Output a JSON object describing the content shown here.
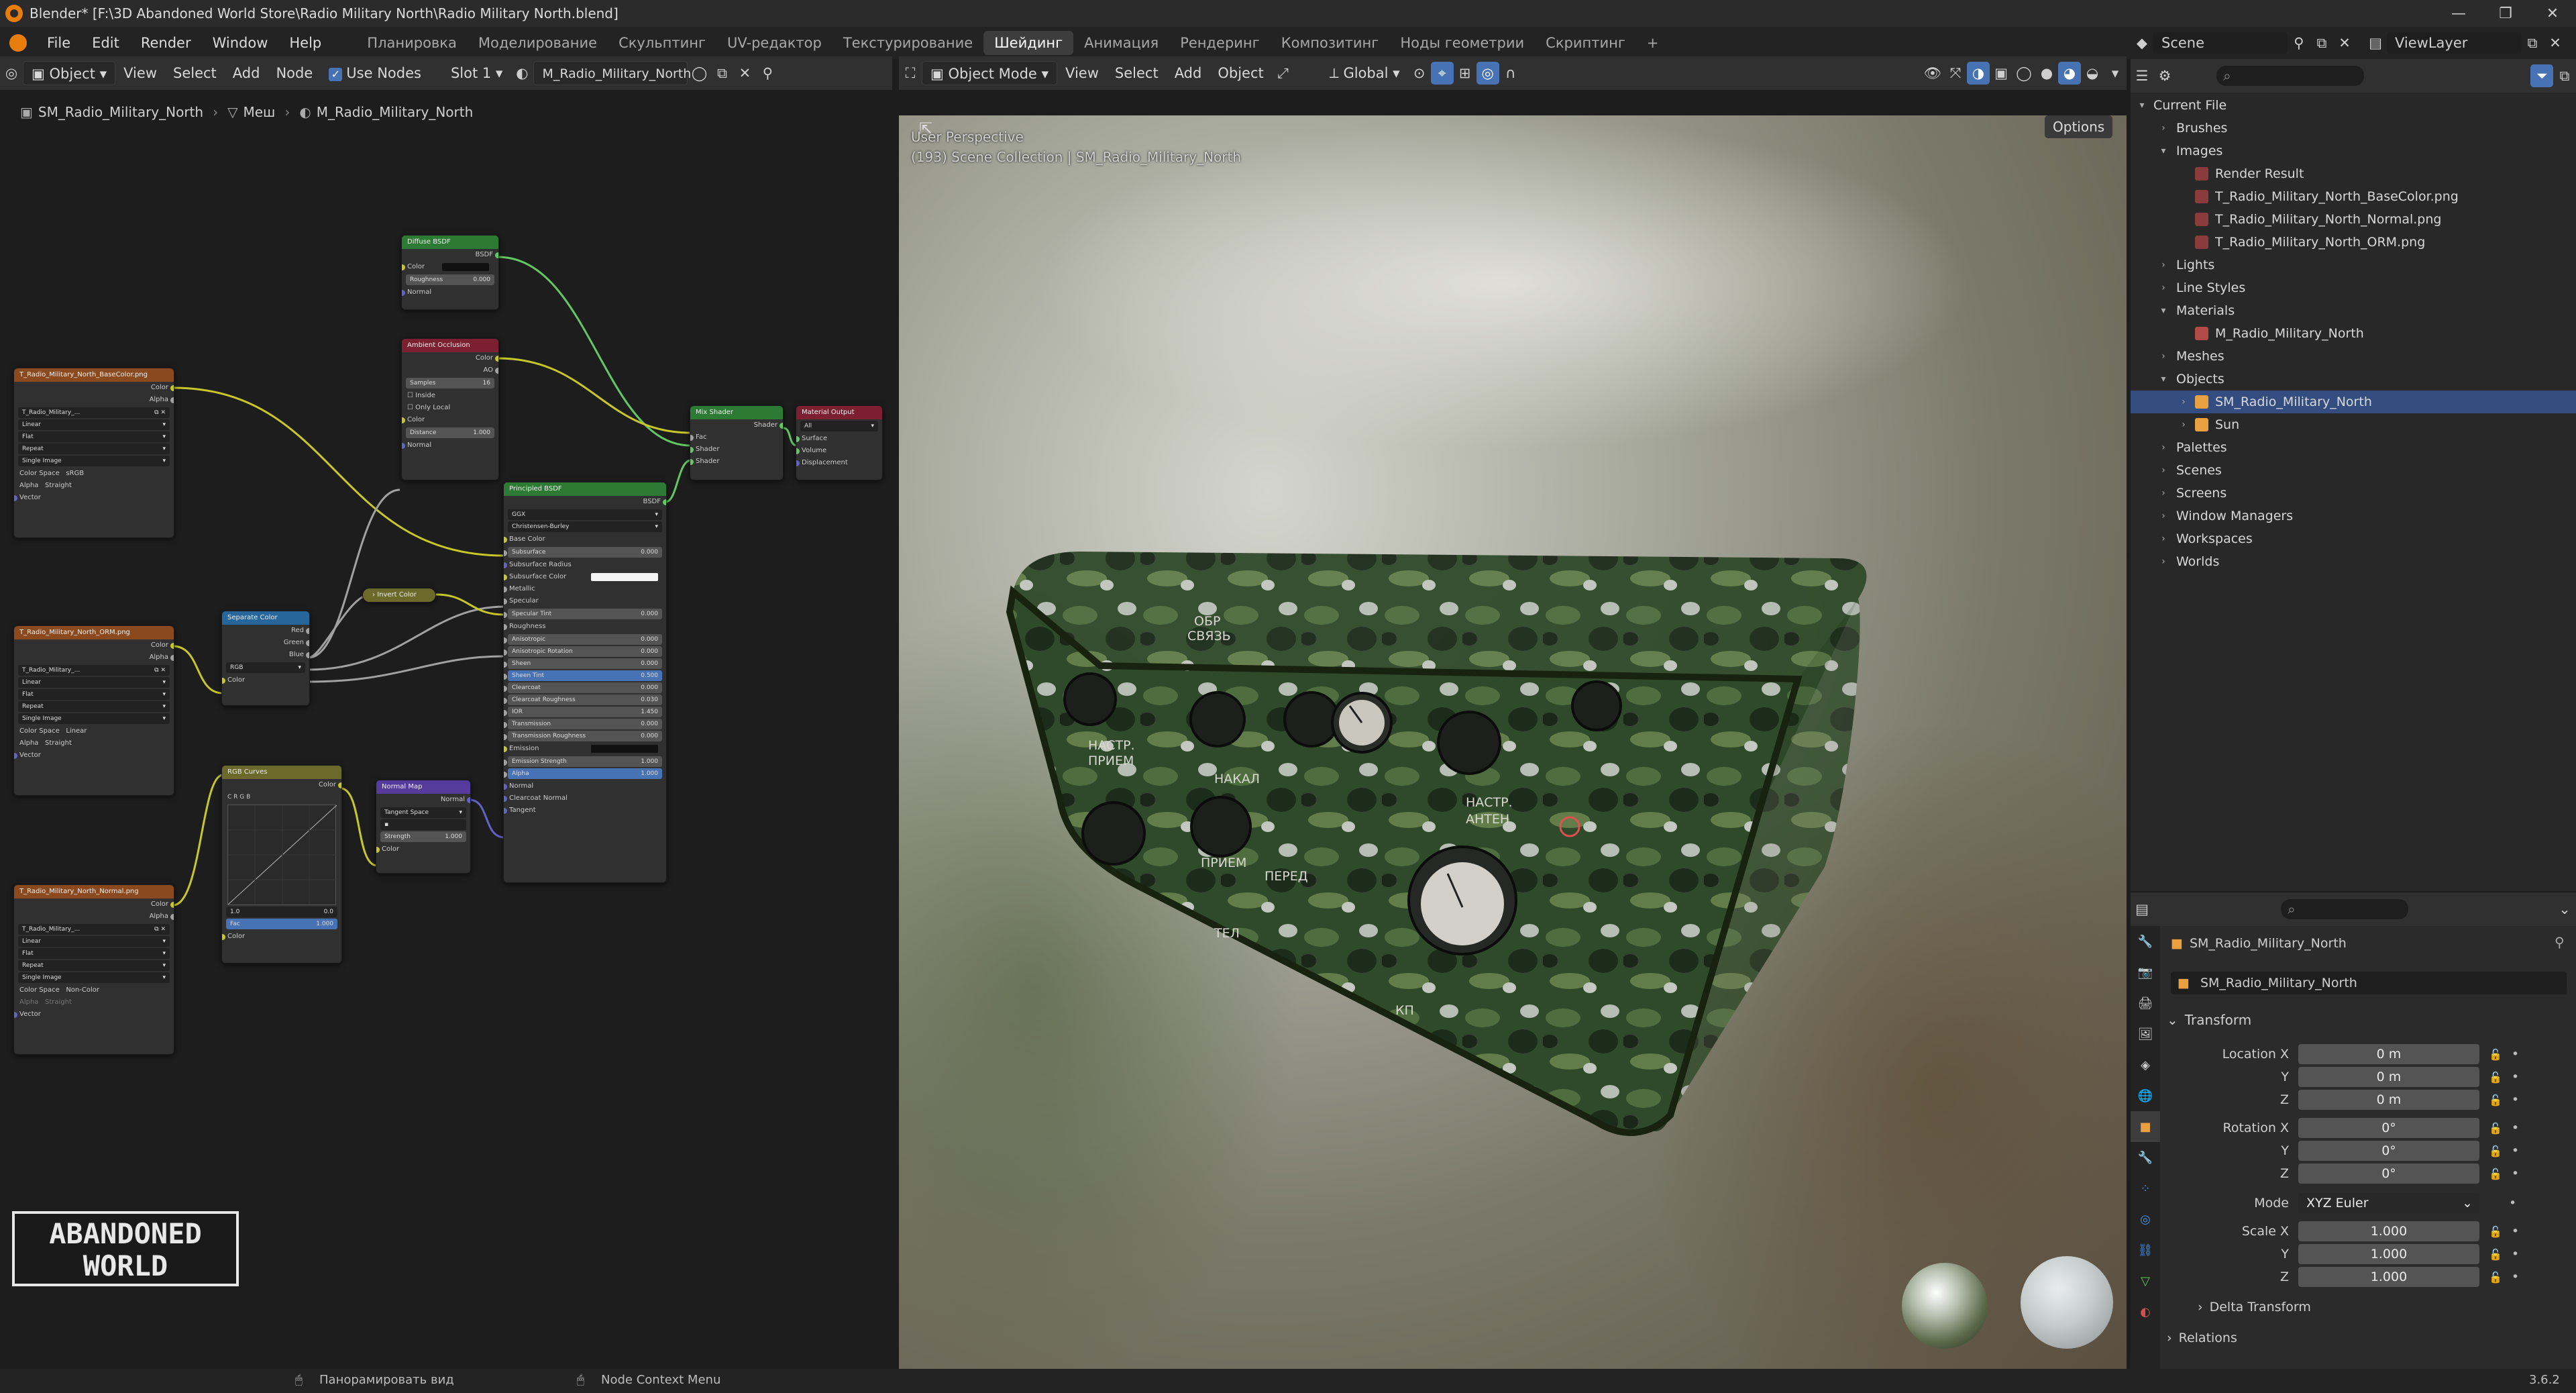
{
  "window": {
    "title": "Blender* [F:\\3D Abandoned World Store\\Radio Military North\\Radio Military North.blend]",
    "minimize": "—",
    "maximize": "❐",
    "close": "✕"
  },
  "menu": {
    "items": [
      "File",
      "Edit",
      "Render",
      "Window",
      "Help"
    ],
    "workspaces": [
      "Планировка",
      "Моделирование",
      "Скульптинг",
      "UV-редактор",
      "Текстурирование",
      "Шейдинг",
      "Анимация",
      "Рендеринг",
      "Композитинг",
      "Ноды геометрии",
      "Скриптинг"
    ],
    "active_workspace": "Шейдинг",
    "add_workspace": "+",
    "scene": "Scene",
    "view_layer": "ViewLayer"
  },
  "node_header": {
    "object_dd": "Object",
    "view": "View",
    "select": "Select",
    "add": "Add",
    "node": "Node",
    "use_nodes": "Use Nodes",
    "slot": "Slot 1",
    "material": "M_Radio_Military_North"
  },
  "breadcrumb": {
    "object": "SM_Radio_Military_North",
    "mesh": "Меш",
    "material": "M_Radio_Military_North"
  },
  "nodes": {
    "diffuse": {
      "title": "Diffuse BSDF",
      "out": "BSDF",
      "color": "Color",
      "roughness": "Roughness",
      "roughness_val": "0.000",
      "normal": "Normal"
    },
    "ao": {
      "title": "Ambient Occlusion",
      "out_color": "Color",
      "out_ao": "AO",
      "samples": "Samples",
      "samples_val": "16",
      "inside": "Inside",
      "only_local": "Only Local",
      "color": "Color",
      "distance": "Distance",
      "distance_val": "1.000",
      "normal": "Normal"
    },
    "mix": {
      "title": "Mix Shader",
      "out": "Shader",
      "fac": "Fac",
      "shader1": "Shader",
      "shader2": "Shader"
    },
    "output": {
      "title": "Material Output",
      "target": "All",
      "surface": "Surface",
      "volume": "Volume",
      "displacement": "Displacement"
    },
    "tex_base": {
      "title": "T_Radio_Military_North_BaseColor.png",
      "color": "Color",
      "alpha": "Alpha",
      "img": "T_Radio_Military_...",
      "interp": "Linear",
      "proj": "Flat",
      "ext": "Repeat",
      "src": "Single Image",
      "cs_label": "Color Space",
      "cs_val": "sRGB",
      "alpha_label": "Alpha",
      "alpha_val": "Straight",
      "vector": "Vector"
    },
    "tex_orm": {
      "title": "T_Radio_Military_North_ORM.png",
      "color": "Color",
      "alpha": "Alpha",
      "img": "T_Radio_Military_...",
      "interp": "Linear",
      "proj": "Flat",
      "ext": "Repeat",
      "src": "Single Image",
      "cs_label": "Color Space",
      "cs_val": "Linear",
      "alpha_label": "Alpha",
      "alpha_val": "Straight",
      "vector": "Vector"
    },
    "tex_nrm": {
      "title": "T_Radio_Military_North_Normal.png",
      "color": "Color",
      "alpha": "Alpha",
      "img": "T_Radio_Military_...",
      "interp": "Linear",
      "proj": "Flat",
      "ext": "Repeat",
      "src": "Single Image",
      "cs_label": "Color Space",
      "cs_val": "Non-Color",
      "alpha_label": "Alpha",
      "alpha_val": "Straight",
      "vector": "Vector"
    },
    "separate": {
      "title": "Separate Color",
      "red": "Red",
      "green": "Green",
      "blue": "Blue",
      "mode": "RGB",
      "color": "Color"
    },
    "invert": {
      "title": "Invert Color"
    },
    "curves": {
      "title": "RGB Curves",
      "out": "Color",
      "fac": "Fac",
      "fac_val": "1.000",
      "color": "Color",
      "channels": "C R G B",
      "val1": "1.0",
      "val2": "0.0"
    },
    "normalmap": {
      "title": "Normal Map",
      "out": "Normal",
      "space": "Tangent Space",
      "strength": "Strength",
      "strength_val": "1.000",
      "color": "Color"
    },
    "principled": {
      "title": "Principled BSDF",
      "out": "BSDF",
      "dist": "GGX",
      "sss": "Christensen-Burley",
      "rows": [
        [
          "Base Color",
          ""
        ],
        [
          "Subsurface",
          "0.000"
        ],
        [
          "Subsurface Radius",
          ""
        ],
        [
          "Subsurface Color",
          ""
        ],
        [
          "Metallic",
          ""
        ],
        [
          "Specular",
          ""
        ],
        [
          "Specular Tint",
          "0.000"
        ],
        [
          "Roughness",
          ""
        ],
        [
          "Anisotropic",
          "0.000"
        ],
        [
          "Anisotropic Rotation",
          "0.000"
        ],
        [
          "Sheen",
          "0.000"
        ],
        [
          "Sheen Tint",
          "0.500"
        ],
        [
          "Clearcoat",
          "0.000"
        ],
        [
          "Clearcoat Roughness",
          "0.030"
        ],
        [
          "IOR",
          "1.450"
        ],
        [
          "Transmission",
          "0.000"
        ],
        [
          "Transmission Roughness",
          "0.000"
        ],
        [
          "Emission",
          ""
        ],
        [
          "Emission Strength",
          "1.000"
        ],
        [
          "Alpha",
          "1.000"
        ],
        [
          "Normal",
          ""
        ],
        [
          "Clearcoat Normal",
          ""
        ],
        [
          "Tangent",
          ""
        ]
      ]
    }
  },
  "logo_text": [
    "ABANDONED",
    "WORLD"
  ],
  "viewport_header": {
    "mode": "Object Mode",
    "view": "View",
    "select": "Select",
    "add": "Add",
    "object": "Object",
    "transform": "Global",
    "options": "Options"
  },
  "viewport": {
    "perspective": "User Perspective",
    "collection": "(193) Scene Collection | SM_Radio_Military_North",
    "panel_labels": [
      "ОБР",
      "СВЯЗЬ",
      "НАСТР.",
      "ПРИЕМ",
      "НАКАЛ",
      "ПРИЕМ",
      "ПЕРЕД",
      "НАСТР.",
      "АНТЕН",
      "ТЕЛ",
      "КП"
    ]
  },
  "outliner": {
    "root": "Current File",
    "items": [
      {
        "label": "Brushes",
        "level": 1,
        "open": false
      },
      {
        "label": "Images",
        "level": 1,
        "open": true
      },
      {
        "label": "Render Result",
        "level": 2
      },
      {
        "label": "T_Radio_Military_North_BaseColor.png",
        "level": 2
      },
      {
        "label": "T_Radio_Military_North_Normal.png",
        "level": 2
      },
      {
        "label": "T_Radio_Military_North_ORM.png",
        "level": 2
      },
      {
        "label": "Lights",
        "level": 1,
        "open": false
      },
      {
        "label": "Line Styles",
        "level": 1,
        "open": false
      },
      {
        "label": "Materials",
        "level": 1,
        "open": true
      },
      {
        "label": "M_Radio_Military_North",
        "level": 2
      },
      {
        "label": "Meshes",
        "level": 1,
        "open": false
      },
      {
        "label": "Objects",
        "level": 1,
        "open": true
      },
      {
        "label": "SM_Radio_Military_North",
        "level": 2,
        "selected": true
      },
      {
        "label": "Sun",
        "level": 2
      },
      {
        "label": "Palettes",
        "level": 1,
        "open": false
      },
      {
        "label": "Scenes",
        "level": 1,
        "open": false
      },
      {
        "label": "Screens",
        "level": 1,
        "open": false
      },
      {
        "label": "Window Managers",
        "level": 1,
        "open": false
      },
      {
        "label": "Workspaces",
        "level": 1,
        "open": false
      },
      {
        "label": "Worlds",
        "level": 1,
        "open": false
      }
    ]
  },
  "properties": {
    "object_name": "SM_Radio_Military_North",
    "object_name_field": "SM_Radio_Military_North",
    "transform": "Transform",
    "location_x_label": "Location X",
    "location_x": "0 m",
    "location_y_label": "Y",
    "location_y": "0 m",
    "location_z_label": "Z",
    "location_z": "0 m",
    "rotation_x_label": "Rotation X",
    "rotation_x": "0°",
    "rotation_y_label": "Y",
    "rotation_y": "0°",
    "rotation_z_label": "Z",
    "rotation_z": "0°",
    "mode_label": "Mode",
    "mode": "XYZ Euler",
    "scale_x_label": "Scale X",
    "scale_x": "1.000",
    "scale_y_label": "Y",
    "scale_y": "1.000",
    "scale_z_label": "Z",
    "scale_z": "1.000",
    "delta": "Delta Transform",
    "relations": "Relations"
  },
  "statusbar": {
    "left": "Панорамировать вид",
    "mid": "Node Context Menu",
    "version": "3.6.2"
  },
  "colors": {
    "accent": "#4772b3",
    "selected_row": "#334d80",
    "texture_header": "#8b4a1e",
    "shader_header": "#2c7a34",
    "blender_orange": "#e87d0d"
  }
}
